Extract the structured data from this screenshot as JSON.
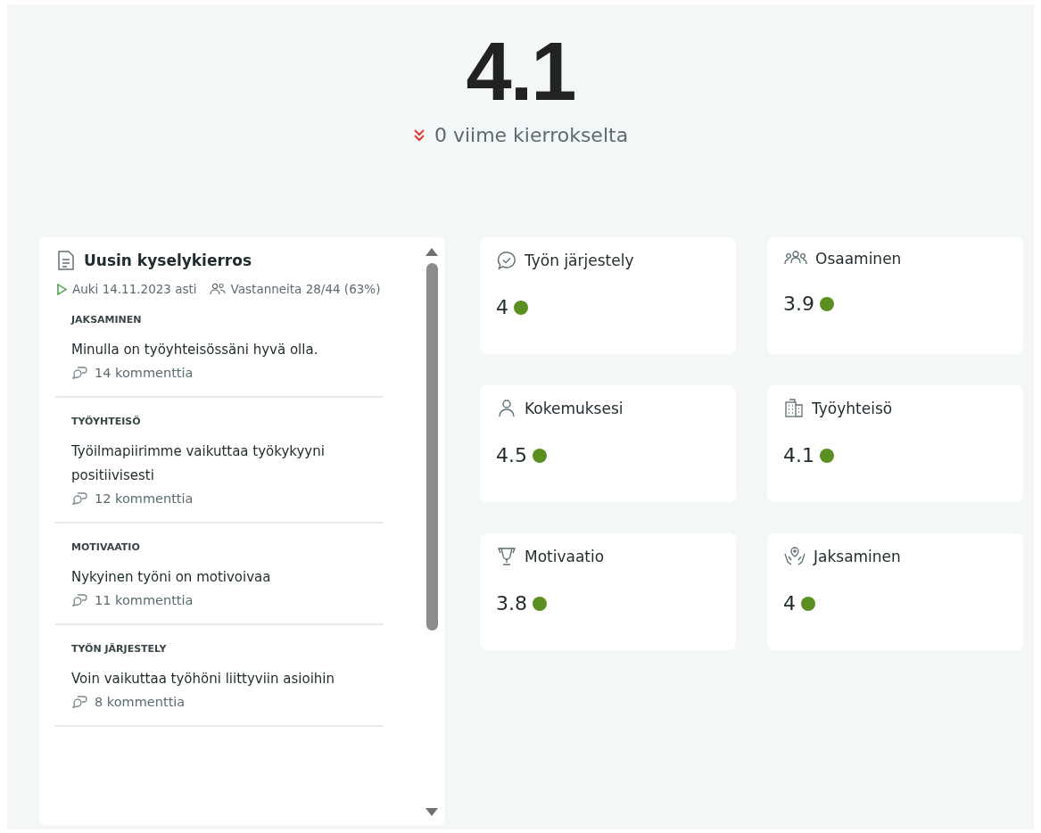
{
  "overall": {
    "score": "4.1",
    "kind": "down",
    "change": "0 viime kierrokselta"
  },
  "survey": {
    "title": "Uusin kyselykierros",
    "open_until": "Auki 14.11.2023 asti",
    "respondents": "Vastanneita 28/44 (63%)",
    "questions": [
      {
        "category": "JAKSAMINEN",
        "text": "Minulla on työyhteisössäni hyvä olla.",
        "comments": "14 kommenttia"
      },
      {
        "category": "TYÖYHTEISÖ",
        "text": "Työilmapiirimme vaikuttaa työkykyyni positiivisesti",
        "comments": "12 kommenttia"
      },
      {
        "category": "MOTIVAATIO",
        "text": "Nykyinen työni on motivoivaa",
        "comments": "11 kommenttia"
      },
      {
        "category": "TYÖN JÄRJESTELY",
        "text": "Voin vaikuttaa työhöni liittyviin asioihin",
        "comments": "8 kommenttia"
      }
    ]
  },
  "categories": [
    {
      "kind": "chat",
      "title": "Työn järjestely",
      "score": "4",
      "color": "#5b8f22"
    },
    {
      "kind": "group",
      "title": "Osaaminen",
      "score": "3.9",
      "color": "#5b8f22"
    },
    {
      "kind": "person",
      "title": "Kokemuksesi",
      "score": "4.5",
      "color": "#5b8f22"
    },
    {
      "kind": "building",
      "title": "Työyhteisö",
      "score": "4.1",
      "color": "#5b8f22"
    },
    {
      "kind": "trophy",
      "title": "Motivaatio",
      "score": "3.8",
      "color": "#5b8f22"
    },
    {
      "kind": "care",
      "title": "Jaksaminen",
      "score": "4",
      "color": "#5b8f22"
    }
  ]
}
